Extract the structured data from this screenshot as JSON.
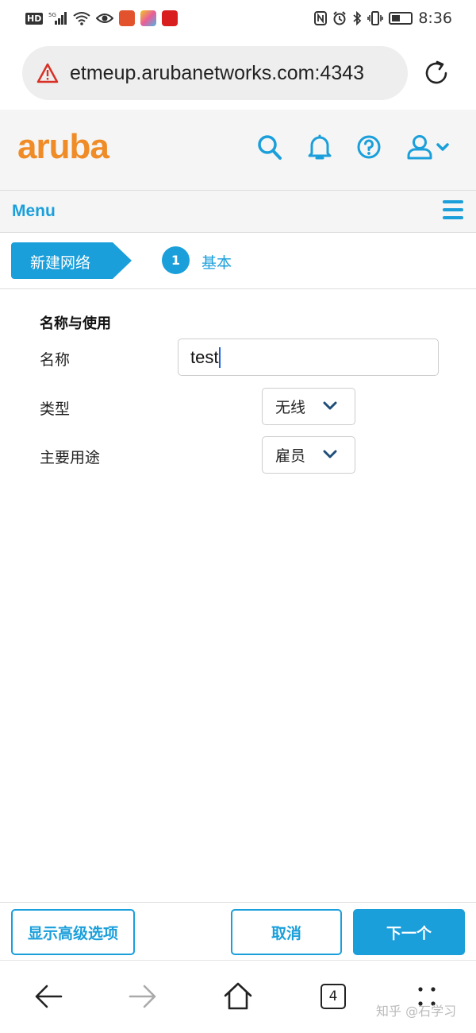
{
  "status_bar": {
    "left_icons": [
      "hd-icon",
      "5g-signal-icon",
      "wifi-icon",
      "eye-icon"
    ],
    "time": "8:36"
  },
  "browser": {
    "url": "etmeup.arubanetworks.com:4343"
  },
  "header": {
    "logo_text": "aruba"
  },
  "menu_bar": {
    "label": "Menu"
  },
  "wizard": {
    "tag": "新建网络",
    "step_number": "1",
    "step_name": "基本"
  },
  "form": {
    "section_title": "名称与使用",
    "name_label": "名称",
    "name_value": "test",
    "type_label": "类型",
    "type_value": "无线",
    "usage_label": "主要用途",
    "usage_value": "雇员"
  },
  "footer": {
    "advanced_button": "显示高级选项",
    "cancel_button": "取消",
    "next_button": "下一个"
  },
  "nav_bar": {
    "tab_count": "4",
    "watermark": "知乎 @石学习"
  },
  "colors": {
    "accent": "#1a9fdb",
    "brand_orange": "#f08c28"
  }
}
